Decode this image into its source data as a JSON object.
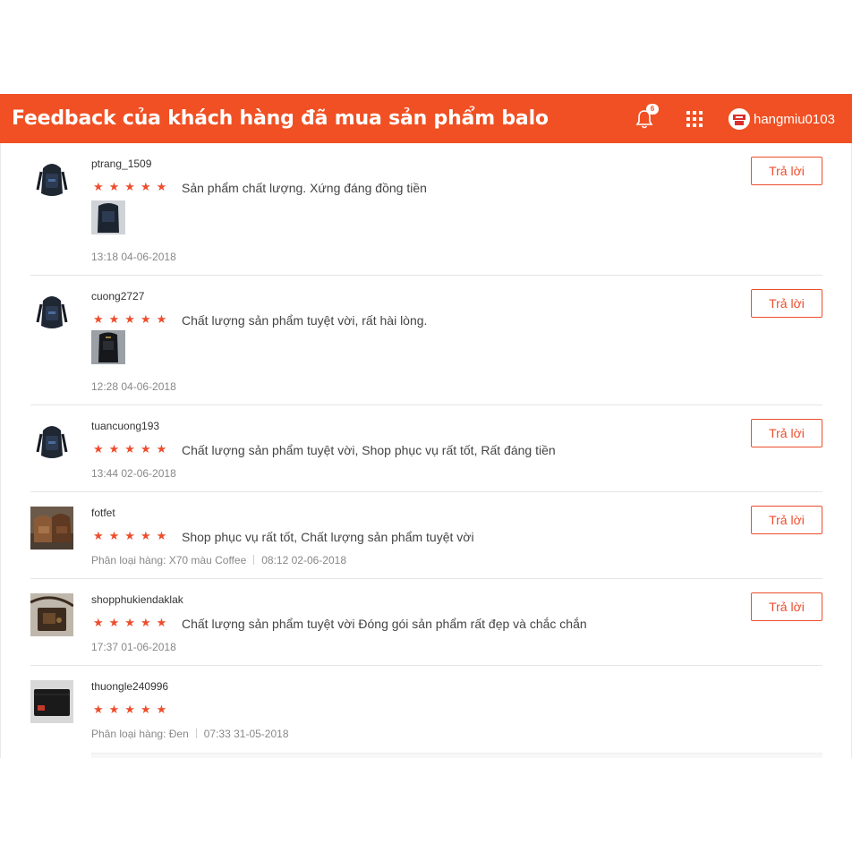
{
  "header": {
    "title": "Feedback của khách hàng đã mua sản phẩm balo",
    "notification_count": "6",
    "username": "hangmiu0103",
    "bg_color": "#f05023"
  },
  "reply_label": "Trả lời",
  "stars": "★★★★★",
  "reviews": [
    {
      "username": "ptrang_1509",
      "text": "Sản phẩm chất lượng. Xứng đáng đồng tiền",
      "has_image": true,
      "variation": "",
      "time": "13:18 04-06-2018",
      "rating": 5
    },
    {
      "username": "cuong2727",
      "text": "Chất lượng sản phẩm tuyệt vời, rất hài lòng.",
      "has_image": true,
      "variation": "",
      "time": "12:28 04-06-2018",
      "rating": 5
    },
    {
      "username": "tuancuong193",
      "text": "Chất lượng sản phẩm tuyệt vời, Shop phục vụ rất tốt, Rất đáng tiền",
      "has_image": false,
      "variation": "",
      "time": "13:44 02-06-2018",
      "rating": 5
    },
    {
      "username": "fotfet",
      "text": "Shop phục vụ rất tốt, Chất lượng sản phẩm tuyệt vời",
      "has_image": false,
      "variation": "Phân loại hàng: X70 màu Coffee",
      "time": "08:12 02-06-2018",
      "rating": 5
    },
    {
      "username": "shopphukiendaklak",
      "text": "Chất lượng sản phẩm tuyệt vời Đóng gói sản phẩm rất đẹp và chắc chắn",
      "has_image": false,
      "variation": "",
      "time": "17:37 01-06-2018",
      "rating": 5
    },
    {
      "username": "thuongle240996",
      "text": "",
      "has_image": false,
      "variation": "Phân loại hàng: Đen",
      "time": "07:33 31-05-2018",
      "rating": 5
    }
  ]
}
